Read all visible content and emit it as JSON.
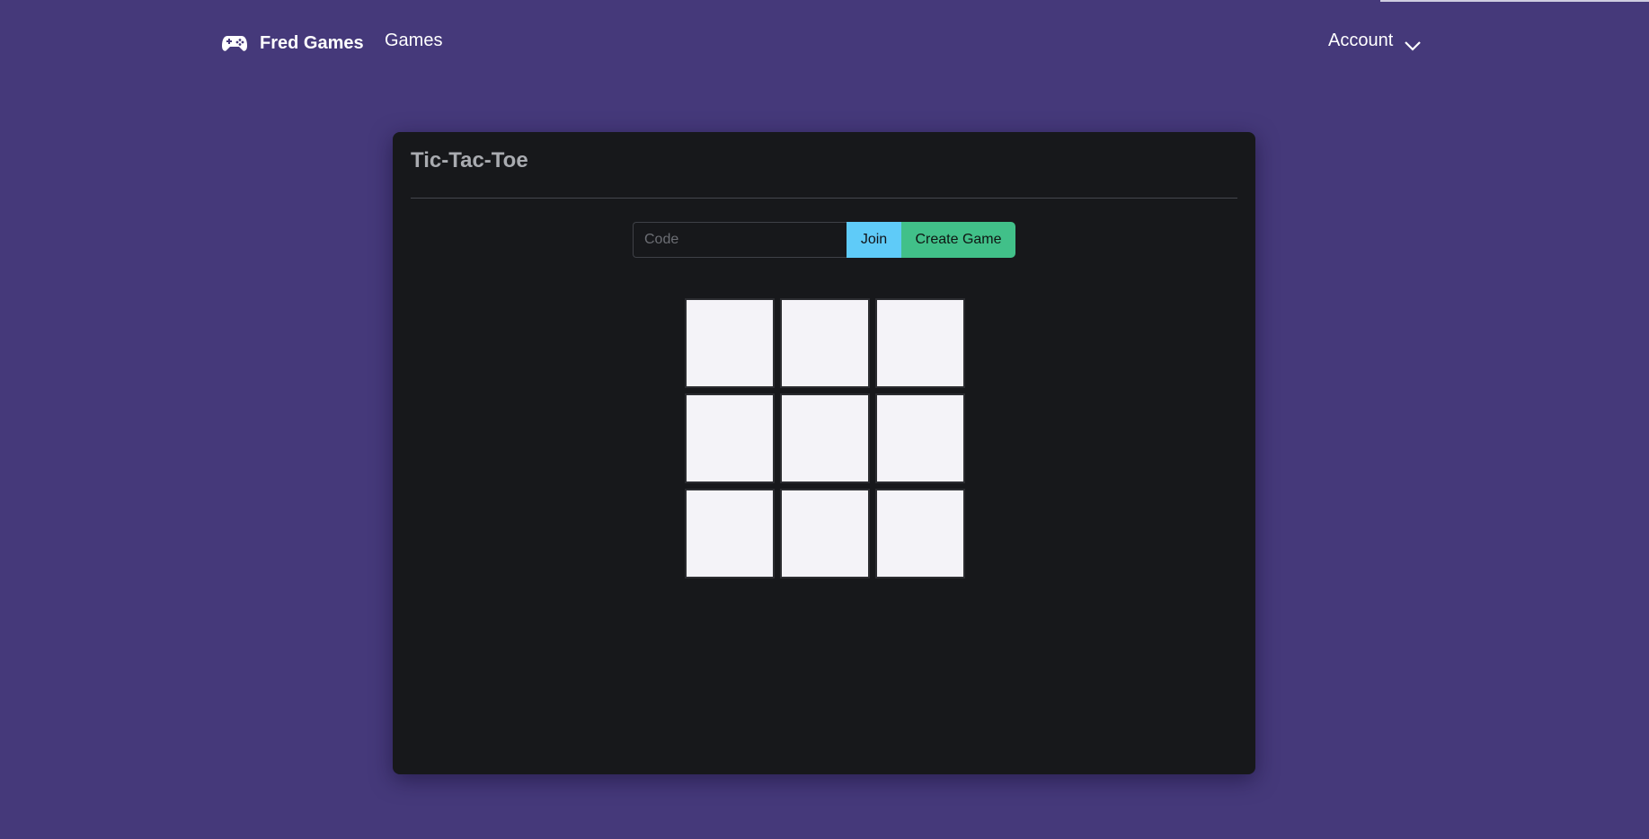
{
  "navbar": {
    "brand_label": "Fred Games",
    "brand_icon": "gamepad-icon",
    "games_link": "Games",
    "account_label": "Account",
    "account_icon": "chevron-down-icon"
  },
  "game": {
    "title": "Tic-Tac-Toe",
    "code_placeholder": "Code",
    "code_value": "",
    "join_label": "Join",
    "create_label": "Create Game",
    "board": [
      "",
      "",
      "",
      "",
      "",
      "",
      "",
      "",
      ""
    ]
  },
  "colors": {
    "background": "#45397a",
    "card": "#17181b",
    "join_button": "#5fcbf8",
    "create_button": "#41c089",
    "cell": "#f4f3f8"
  }
}
